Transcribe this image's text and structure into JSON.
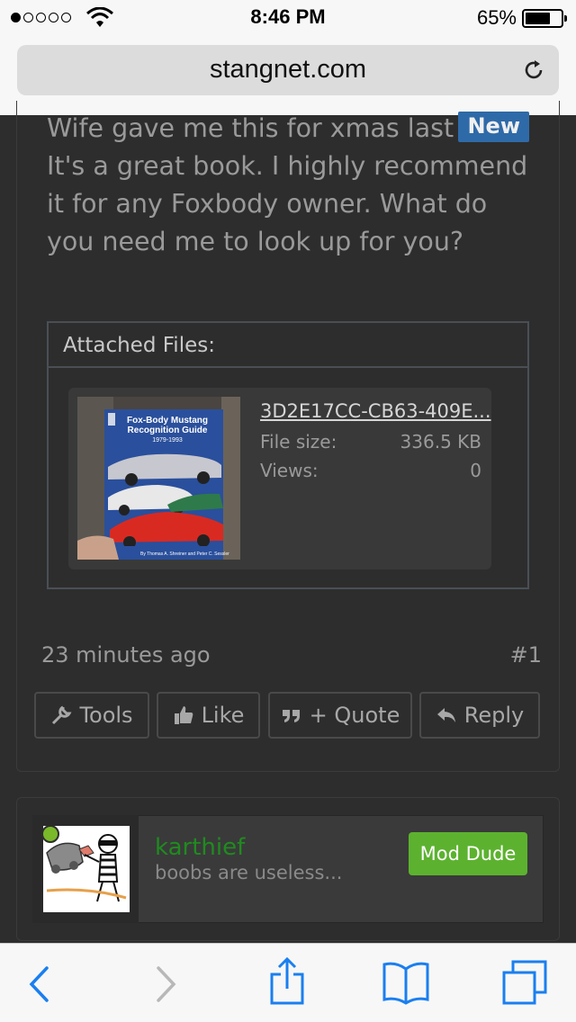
{
  "status_bar": {
    "time": "8:46 PM",
    "battery_percent": "65%",
    "battery_level": 0.65,
    "signal_dots_filled": 1,
    "signal_dots_total": 5
  },
  "browser": {
    "url": "stangnet.com"
  },
  "post": {
    "body": "Wife gave me this for xmas last year. It's a great book. I highly recommend it for any Foxbody owner. What do you need me to look up for you?",
    "new_badge": "New",
    "attachments": {
      "heading": "Attached Files:",
      "file_name": "3D2E17CC-CB63-409E...",
      "file_size_label": "File size:",
      "file_size_value": "336.5 KB",
      "views_label": "Views:",
      "views_value": "0",
      "thumb_title": "Fox-Body Mustang Recognition Guide",
      "thumb_years": "1979-1993"
    },
    "timestamp": "23 minutes ago",
    "post_number": "#1",
    "actions": {
      "tools": "Tools",
      "like": "Like",
      "quote": "+ Quote",
      "reply": "Reply"
    }
  },
  "next_post": {
    "username": "karthief",
    "user_status": "boobs are useless...",
    "badge": "Mod Dude"
  },
  "colors": {
    "new_badge": "#2f6aa8",
    "mod_badge": "#5cb22f",
    "username": "#1f8b1f",
    "ios_blue": "#1a7ff0"
  }
}
